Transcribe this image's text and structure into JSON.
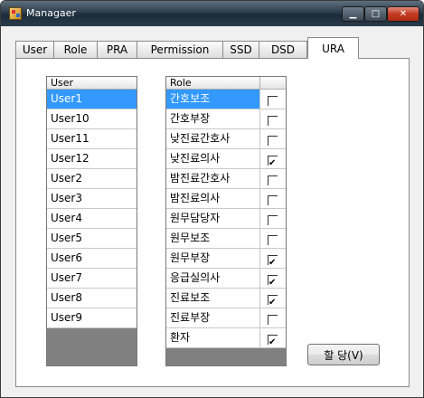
{
  "window": {
    "title": "Managaer"
  },
  "tabs": [
    {
      "label": "User"
    },
    {
      "label": "Role"
    },
    {
      "label": "PRA"
    },
    {
      "label": "Permission"
    },
    {
      "label": "SSD"
    },
    {
      "label": "DSD"
    },
    {
      "label": "URA",
      "active": true
    }
  ],
  "user_list": {
    "header": "User",
    "selected": "User1",
    "items": [
      "User1",
      "User10",
      "User11",
      "User12",
      "User2",
      "User3",
      "User4",
      "User5",
      "User6",
      "User7",
      "User8",
      "User9"
    ]
  },
  "role_list": {
    "header": "Role",
    "selected": "간호보조",
    "items": [
      {
        "name": "간호보조",
        "checked": false
      },
      {
        "name": "간호부장",
        "checked": false
      },
      {
        "name": "낮진료간호사",
        "checked": false
      },
      {
        "name": "낮진료의사",
        "checked": true
      },
      {
        "name": "밤진료간호사",
        "checked": false
      },
      {
        "name": "밤진료의사",
        "checked": false
      },
      {
        "name": "원무담당자",
        "checked": false
      },
      {
        "name": "원무보조",
        "checked": false
      },
      {
        "name": "원무부장",
        "checked": true
      },
      {
        "name": "응급실의사",
        "checked": true
      },
      {
        "name": "진료보조",
        "checked": true
      },
      {
        "name": "진료부장",
        "checked": false
      },
      {
        "name": "환자",
        "checked": true
      }
    ]
  },
  "assign_button": {
    "label": "할 당(V)"
  },
  "colors": {
    "selection": "#3399ff",
    "titlebar": "#2d3d4c"
  }
}
